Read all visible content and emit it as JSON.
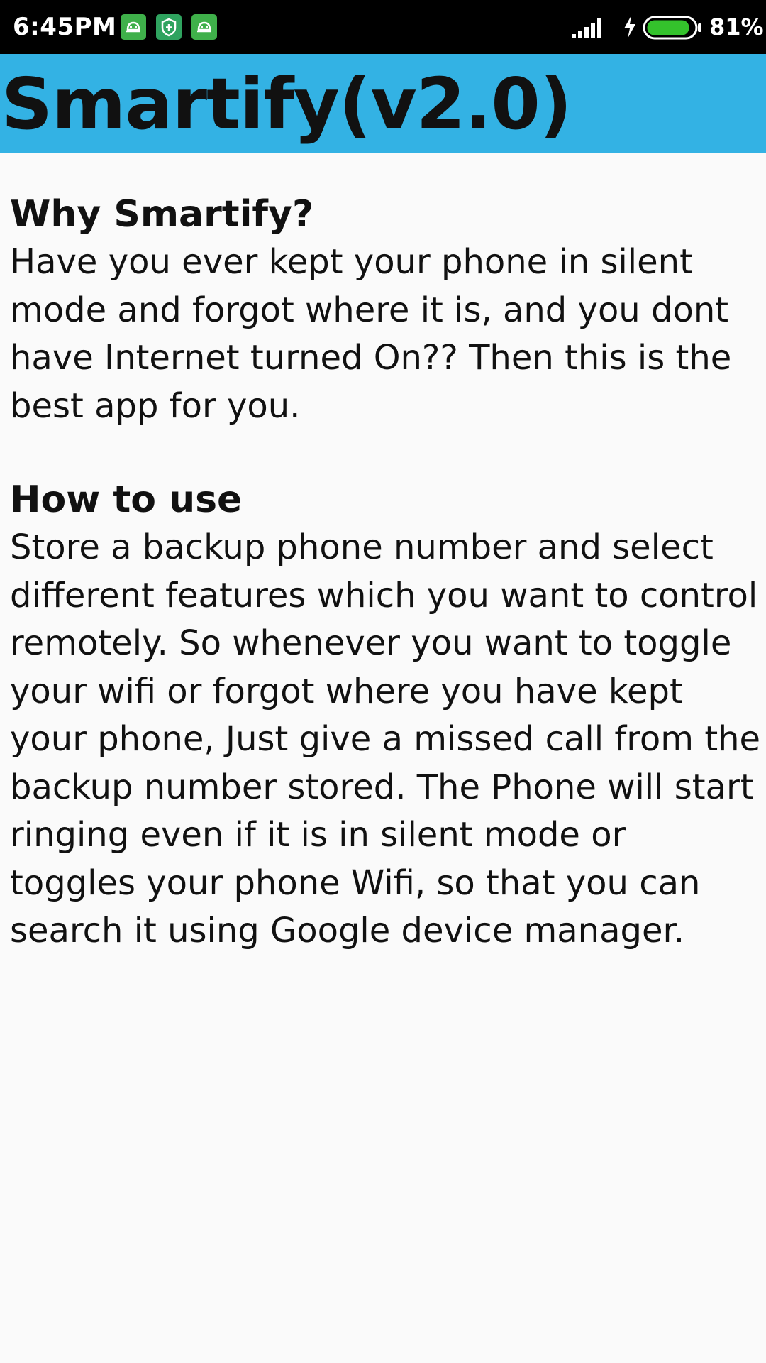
{
  "status_bar": {
    "time": "6:45PM",
    "battery_percent": "81%",
    "battery_level": 0.81,
    "icons": [
      "android-notification-icon",
      "shield-notification-icon",
      "android-notification-icon",
      "signal-icon",
      "charging-icon",
      "battery-icon"
    ]
  },
  "app_bar": {
    "title": "Smartify(v2.0)",
    "color": "#33b2e4"
  },
  "sections": [
    {
      "heading": "Why Smartify?",
      "body": "Have you ever kept your phone in silent mode and forgot where it is, and you dont have Internet turned On?? Then this is the best app for you."
    },
    {
      "heading": "How to use",
      "body": "Store a backup phone number and select different features which you want to control remotely. So whenever you want to toggle your wifi or forgot where you have kept your phone, Just give a missed call from the backup number stored. The Phone will start ringing even if it is in silent mode or toggles your phone Wifi, so that you can search it using Google device manager."
    }
  ]
}
